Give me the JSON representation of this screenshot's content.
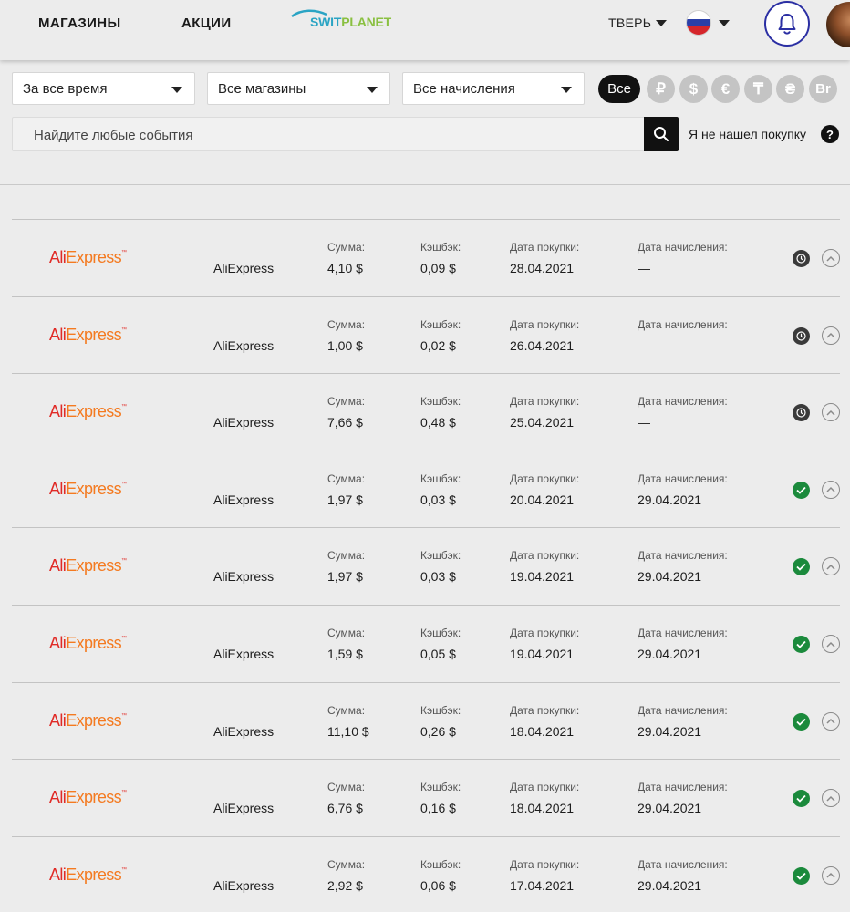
{
  "header": {
    "nav_shops": "МАГАЗИНЫ",
    "nav_promos": "АКЦИИ",
    "logo_part1": "SWIT",
    "logo_part2": "PLANET",
    "city": "ТВЕРЬ",
    "brand_color": "#2aa4c4",
    "accent_color": "#2b2fa3"
  },
  "filters": {
    "period": "За все время",
    "shops": "Все магазины",
    "accruals": "Все начисления",
    "currency_all": "Все",
    "currencies": [
      "₽",
      "$",
      "€",
      "₸",
      "₴",
      "Br"
    ],
    "search_placeholder": "Найдите любые события",
    "not_found_label": "Я не нашел покупку",
    "help_glyph": "?"
  },
  "labels": {
    "amount": "Сумма:",
    "cashback": "Кэшбэк:",
    "purchase_date": "Дата покупки:",
    "accrual_date": "Дата начисления:"
  },
  "logo_text": {
    "part1": "Ali",
    "part2": "Express",
    "tm": "™"
  },
  "status_colors": {
    "pending": "#3a3a3a",
    "done": "#1b8a3c"
  },
  "rows": [
    {
      "store": "AliExpress",
      "amount": "4,10 $",
      "cashback": "0,09 $",
      "purchase_date": "28.04.2021",
      "accrual_date": "—",
      "status": "pending"
    },
    {
      "store": "AliExpress",
      "amount": "1,00 $",
      "cashback": "0,02 $",
      "purchase_date": "26.04.2021",
      "accrual_date": "—",
      "status": "pending"
    },
    {
      "store": "AliExpress",
      "amount": "7,66 $",
      "cashback": "0,48 $",
      "purchase_date": "25.04.2021",
      "accrual_date": "—",
      "status": "pending"
    },
    {
      "store": "AliExpress",
      "amount": "1,97 $",
      "cashback": "0,03 $",
      "purchase_date": "20.04.2021",
      "accrual_date": "29.04.2021",
      "status": "done"
    },
    {
      "store": "AliExpress",
      "amount": "1,97 $",
      "cashback": "0,03 $",
      "purchase_date": "19.04.2021",
      "accrual_date": "29.04.2021",
      "status": "done"
    },
    {
      "store": "AliExpress",
      "amount": "1,59 $",
      "cashback": "0,05 $",
      "purchase_date": "19.04.2021",
      "accrual_date": "29.04.2021",
      "status": "done"
    },
    {
      "store": "AliExpress",
      "amount": "11,10 $",
      "cashback": "0,26 $",
      "purchase_date": "18.04.2021",
      "accrual_date": "29.04.2021",
      "status": "done"
    },
    {
      "store": "AliExpress",
      "amount": "6,76 $",
      "cashback": "0,16 $",
      "purchase_date": "18.04.2021",
      "accrual_date": "29.04.2021",
      "status": "done"
    },
    {
      "store": "AliExpress",
      "amount": "2,92 $",
      "cashback": "0,06 $",
      "purchase_date": "17.04.2021",
      "accrual_date": "29.04.2021",
      "status": "done"
    }
  ]
}
